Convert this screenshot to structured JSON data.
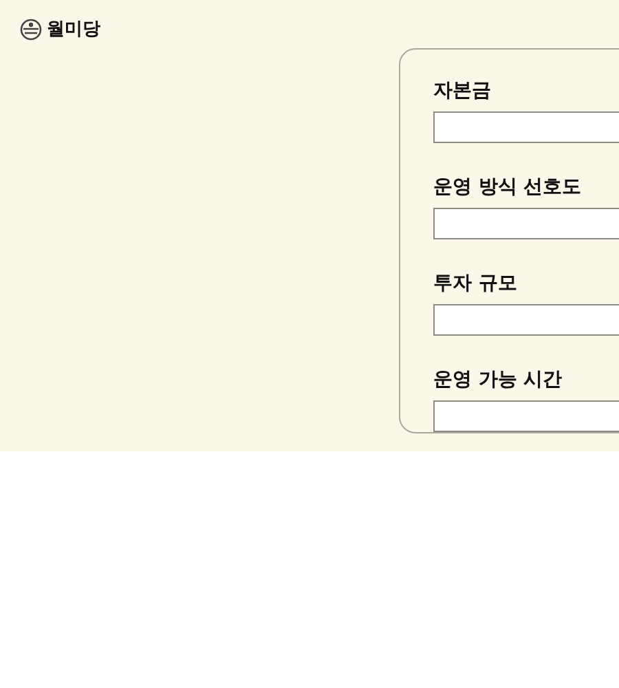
{
  "header": {
    "logo_text": "월미당"
  },
  "form": {
    "fields": [
      {
        "label": "자본금"
      },
      {
        "label": "운영 방식 선호도"
      },
      {
        "label": "투자 규모"
      },
      {
        "label": "운영 가능 시간"
      }
    ]
  }
}
